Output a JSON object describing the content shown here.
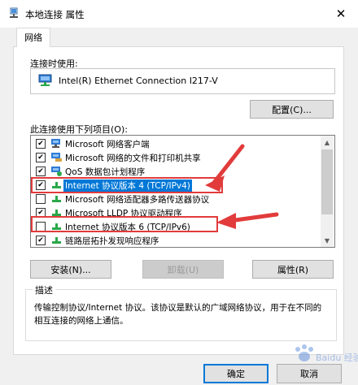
{
  "window": {
    "title": "本地连接 属性",
    "close_glyph": "✕"
  },
  "tabs": [
    {
      "label": "网络"
    }
  ],
  "connect_using": {
    "label": "连接时使用:",
    "adapter": "Intel(R) Ethernet Connection I217-V"
  },
  "buttons": {
    "configure": "配置(C)...",
    "install": "安装(N)...",
    "uninstall": "卸载(U)",
    "properties": "属性(R)",
    "ok": "确定",
    "cancel": "取消"
  },
  "items_label": "此连接使用下列项目(O):",
  "items": [
    {
      "label": "Microsoft 网络客户端",
      "checked": true,
      "icon": "network-client-icon"
    },
    {
      "label": "Microsoft 网络的文件和打印机共享",
      "checked": true,
      "icon": "network-share-icon"
    },
    {
      "label": "QoS 数据包计划程序",
      "checked": true,
      "icon": "qos-icon"
    },
    {
      "label": "Internet 协议版本 4 (TCP/IPv4)",
      "checked": true,
      "icon": "protocol-icon",
      "selected": true
    },
    {
      "label": "Microsoft 网络适配器多路传送器协议",
      "checked": false,
      "icon": "protocol-icon"
    },
    {
      "label": "Microsoft LLDP 协议驱动程序",
      "checked": true,
      "icon": "protocol-icon"
    },
    {
      "label": "Internet 协议版本 6 (TCP/IPv6)",
      "checked": false,
      "icon": "protocol-icon"
    },
    {
      "label": "链路层拓扑发现响应程序",
      "checked": true,
      "icon": "protocol-icon"
    }
  ],
  "description": {
    "legend": "描述",
    "text": "传输控制协议/Internet 协议。该协议是默认的广域网络协议，用于在不同的相互连接的网络上通信。"
  },
  "watermark": "Baidu 经验",
  "colors": {
    "accent": "#0078d7",
    "highlight": "#e23b3b"
  }
}
